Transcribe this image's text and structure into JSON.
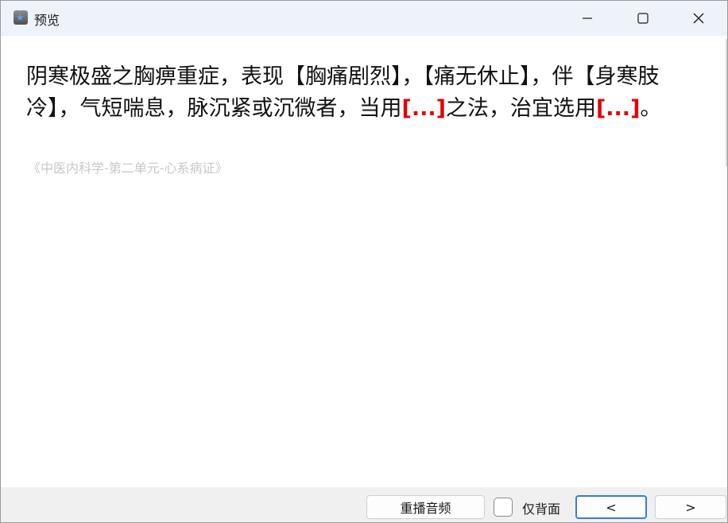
{
  "window": {
    "title": "预览",
    "app_icon": "star-app-icon",
    "controls": {
      "minimize_icon": "minimize-icon",
      "maximize_icon": "maximize-icon",
      "close_icon": "close-icon"
    }
  },
  "card": {
    "question_parts": [
      {
        "text": "阴寒极盛之胸痹重症，表现【胸痛剧烈】，【痛无休止】，伴【身寒肢冷】，气短喘息，脉沉紧或沉微者，当用",
        "type": "text"
      },
      {
        "text": "[...]",
        "type": "blank"
      },
      {
        "text": "之法，治宜选用",
        "type": "text"
      },
      {
        "text": "[...]",
        "type": "blank"
      },
      {
        "text": "。",
        "type": "text"
      }
    ],
    "source": "《中医内科学-第二单元-心系病证》",
    "blank_color": "#e30000"
  },
  "footer": {
    "replay_label": "重播音频",
    "back_only_label": "仅背面",
    "back_only_checked": false,
    "prev_label": "<",
    "next_label": ">"
  }
}
